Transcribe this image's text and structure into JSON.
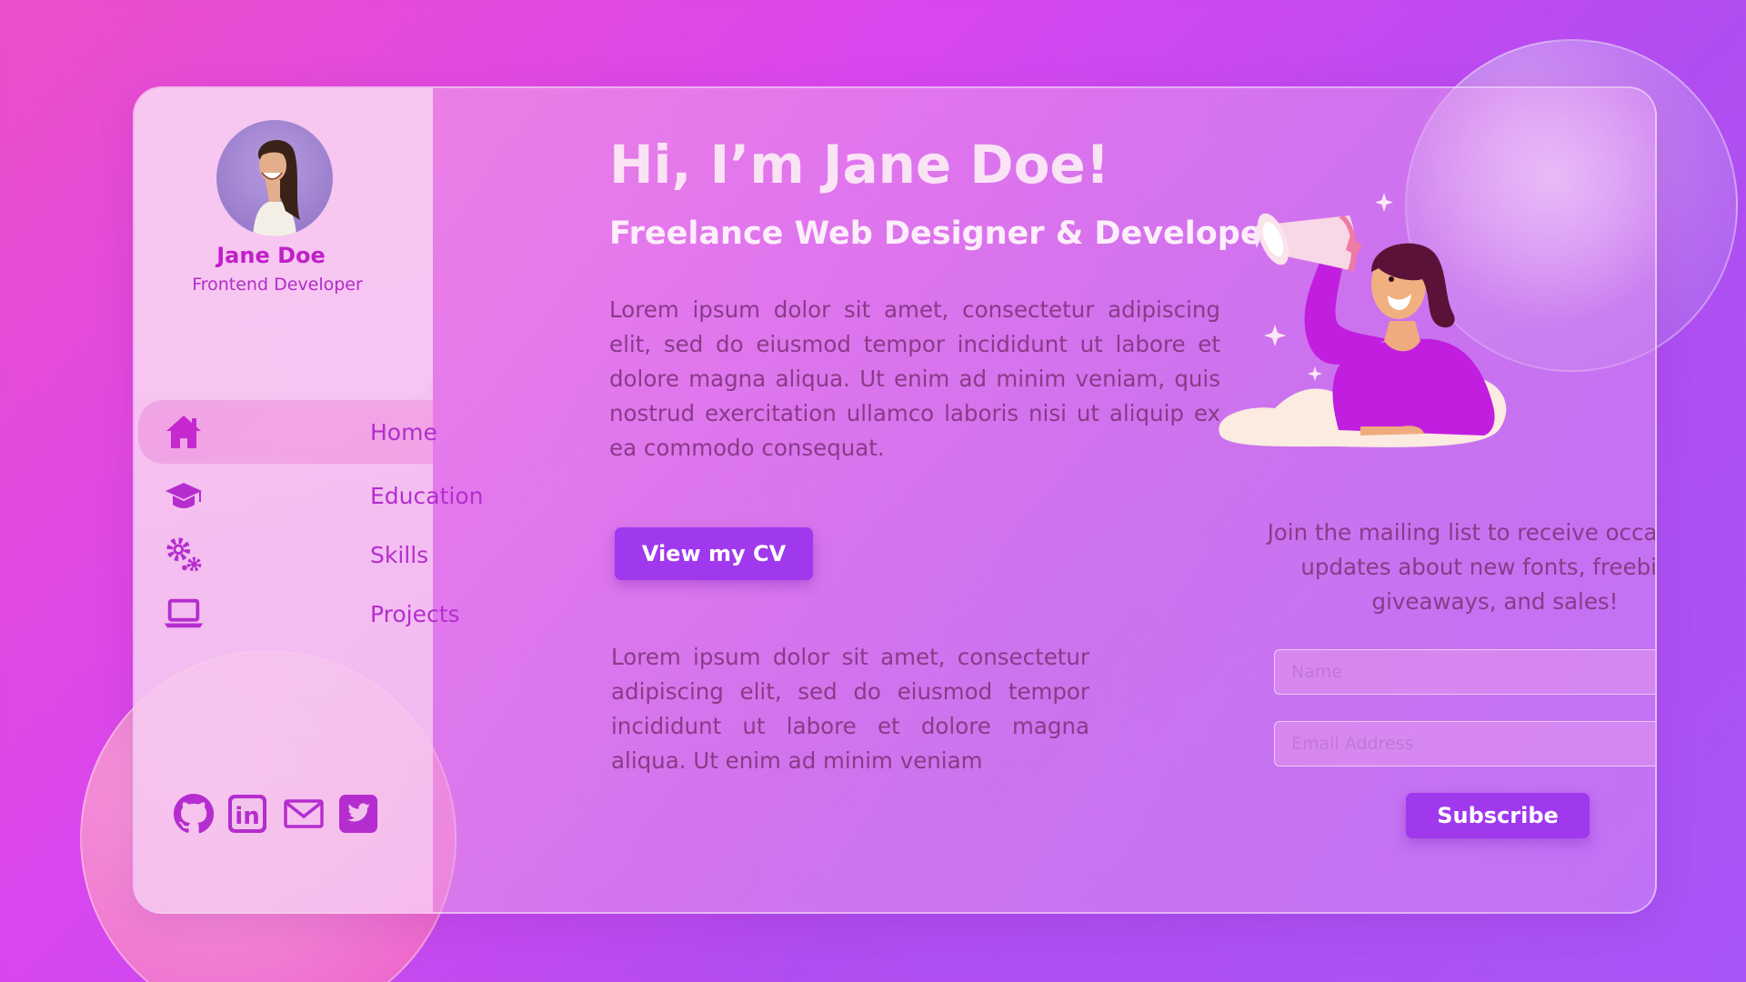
{
  "profile": {
    "name": "Jane Doe",
    "role": "Frontend Developer",
    "avatar_icon": "person-photo"
  },
  "nav": {
    "items": [
      {
        "label": "Home",
        "icon": "home-icon",
        "active": true
      },
      {
        "label": "Education",
        "icon": "graduation-cap-icon",
        "active": false
      },
      {
        "label": "Skills",
        "icon": "gears-icon",
        "active": false
      },
      {
        "label": "Projects",
        "icon": "laptop-icon",
        "active": false
      }
    ]
  },
  "social": {
    "items": [
      {
        "icon": "github-icon"
      },
      {
        "icon": "linkedin-icon",
        "text": "in"
      },
      {
        "icon": "email-icon"
      },
      {
        "icon": "twitter-icon"
      }
    ]
  },
  "hero": {
    "title": "Hi, I’m Jane Doe!",
    "subtitle": "Freelance Web Designer & Developer",
    "paragraph1": "Lorem ipsum dolor sit amet, consectetur adipiscing elit, sed do eiusmod tempor incididunt ut labore et dolore magna aliqua. Ut enim ad minim veniam, quis nostrud exercitation ullamco laboris nisi ut aliquip ex ea commodo consequat.",
    "cv_button": "View my CV",
    "paragraph2": "Lorem ipsum dolor sit amet, consectetur adipiscing elit, sed do eiusmod tempor incididunt ut labore et dolore magna aliqua. Ut enim ad minim veniam"
  },
  "mailing": {
    "text": "Join the mailing list to receive occasional updates about new fonts, freebies, giveaways, and sales!",
    "name_placeholder": "Name",
    "email_placeholder": "Email Address",
    "subscribe_button": "Subscribe"
  },
  "colors": {
    "accent": "#a038ee",
    "nav_text": "#b52dcf",
    "body_text": "#8a3a88",
    "background_start": "#ec4fc9",
    "background_end": "#a855f7"
  }
}
